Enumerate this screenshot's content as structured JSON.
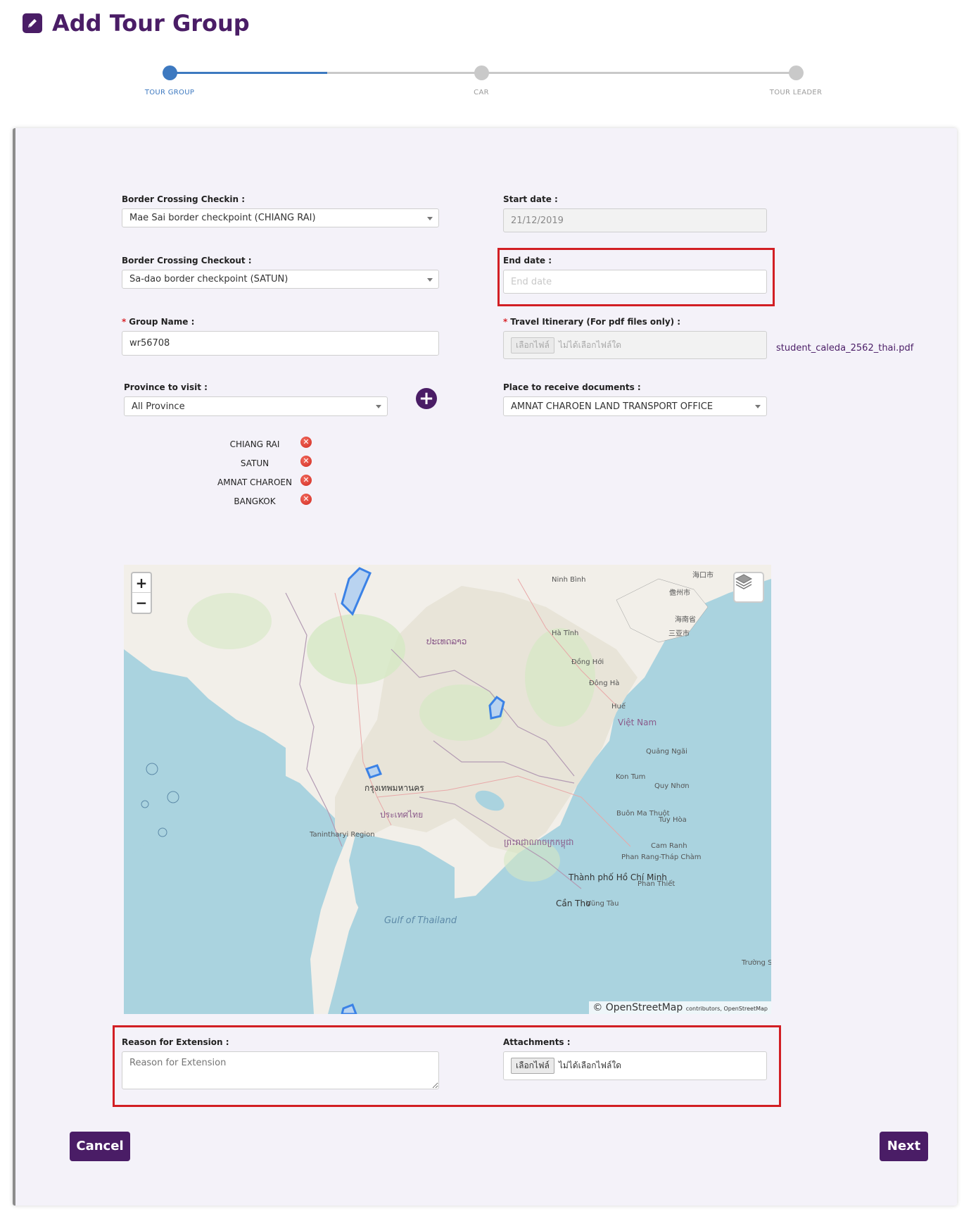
{
  "page": {
    "title": "Add Tour Group"
  },
  "stepper": {
    "steps": [
      "TOUR GROUP",
      "CAR",
      "TOUR LEADER"
    ],
    "current": 1
  },
  "form": {
    "checkin_label": "Border Crossing Checkin :",
    "checkin_value": "Mae Sai border checkpoint (CHIANG RAI)",
    "checkout_label": "Border Crossing Checkout :",
    "checkout_value": "Sa-dao border checkpoint (SATUN)",
    "start_date_label": "Start date :",
    "start_date_value": "21/12/2019",
    "end_date_label": "End date :",
    "end_date_placeholder": "End date",
    "group_name_label": "Group Name :",
    "group_name_value": "wr56708",
    "itinerary_label": "Travel Itinerary (For pdf files only) :",
    "itinerary_button": "เลือกไฟล์",
    "itinerary_status": "ไม่ได้เลือกไฟล์ใด",
    "itinerary_file_link": "student_caleda_2562_thai.pdf",
    "province_label": "Province to visit :",
    "province_value": "All Province",
    "place_label": "Place to receive documents :",
    "place_value": "AMNAT CHAROEN LAND TRANSPORT OFFICE",
    "provinces": [
      "CHIANG RAI",
      "SATUN",
      "AMNAT CHAROEN",
      "BANGKOK"
    ],
    "reason_label": "Reason for Extension :",
    "reason_placeholder": "Reason for Extension",
    "attachments_label": "Attachments :",
    "attachments_button": "เลือกไฟล์",
    "attachments_status": "ไม่ได้เลือกไฟล์ใด"
  },
  "map": {
    "zoom_in": "+",
    "zoom_out": "−",
    "attribution_main": "© OpenStreetMap",
    "attribution_small": "contributors, OpenStreetMap",
    "labels": {
      "gulf": "Gulf of Thailand",
      "vietnam": "Việt Nam",
      "thailand": "ประเทศไทย",
      "bangkok": "กรุงเทพมหานคร",
      "hcmc": "Thành phố Hồ Chí Minh",
      "can_tho": "Cần Thơ",
      "vung_tau": "Vũng Tàu",
      "hue": "Huế",
      "ninh_binh": "Ninh Bình",
      "ha_tinh": "Hà Tĩnh",
      "dong_hoi": "Đồng Hới",
      "dong_ha": "Đông Hà",
      "quang_ngai": "Quảng Ngãi",
      "kon_tum": "Kon Tum",
      "quy_nhon": "Quy Nhơn",
      "buon_ma_thuot": "Buôn Ma Thuột",
      "tuy_hoa": "Tuy Hòa",
      "cam_ranh": "Cam Ranh",
      "phan_rang": "Phan Rang-Tháp Chàm",
      "phan_thiet": "Phan Thiết",
      "haikou": "海口市",
      "danzhou": "儋州市",
      "sanya": "三亚市",
      "hainan": "海南省",
      "tanintharyi": "Tanintharyi Region",
      "truong_sa": "Trường Sa",
      "laos": "ປະເທດລາວ",
      "cambodia": "ព្រះរាជាណាចក្រកម្ពុជា"
    }
  },
  "buttons": {
    "cancel": "Cancel",
    "next": "Next"
  },
  "colors": {
    "primary": "#4a1d66",
    "step_active": "#3d79c0",
    "highlight": "#d21f24",
    "remove": "#d12b21"
  }
}
